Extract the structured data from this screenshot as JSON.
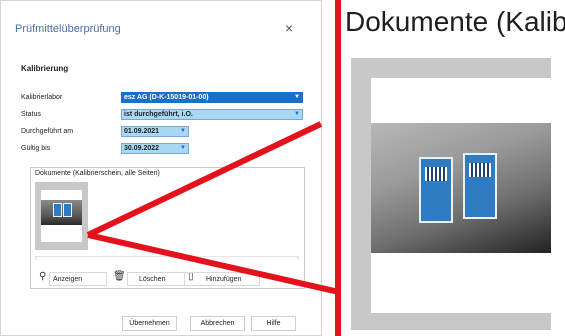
{
  "dialog": {
    "title": "Prüfmittelüberprüfung",
    "close": "×",
    "section": "Kalibrierung",
    "fields": [
      {
        "label": "Kalibrierlabor",
        "value": "esz AG (D-K-15019-01-00)"
      },
      {
        "label": "Status",
        "value": "ist durchgeführt, i.O."
      },
      {
        "label": "Durchgeführt am",
        "value": "01.09.2021"
      },
      {
        "label": "Gültig bis",
        "value": "30.09.2022"
      }
    ],
    "documents_label": "Dokumente (Kalibrierschein, alle Seiten)",
    "scroll_left": "‹",
    "scroll_right": "›",
    "toolbar": {
      "show": "Anzeigen",
      "delete": "Löschen",
      "add": "Hinzufügen"
    },
    "buttons": {
      "apply": "Übernehmen",
      "cancel": "Abbrechen",
      "help": "Hilfe"
    }
  },
  "zoom": {
    "title": "Dokumente (Kalibr"
  },
  "colors": {
    "accent": "#1a6fc9",
    "field_bg": "#a8d8f2",
    "highlight": "#e4121c",
    "title": "#4a6fa5"
  }
}
